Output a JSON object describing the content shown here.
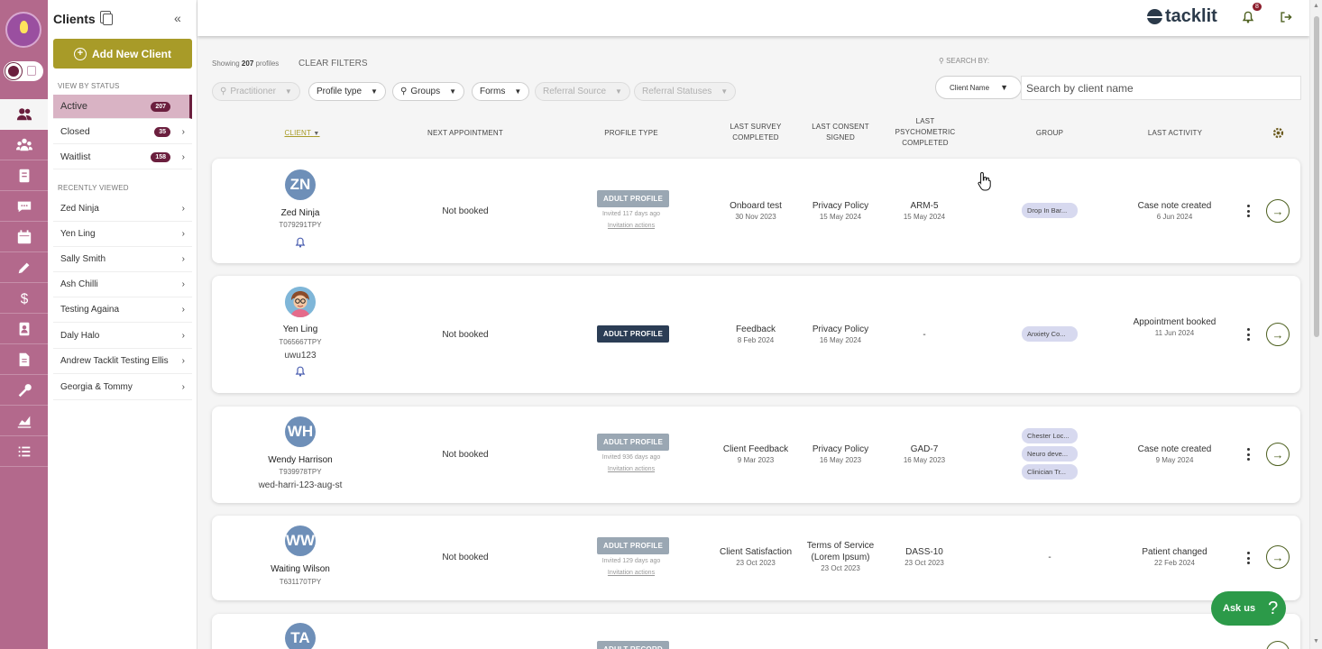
{
  "sidebar": {
    "title": "Clients",
    "add_button": "Add New Client",
    "view_by_status_label": "VIEW BY STATUS",
    "statuses": [
      {
        "label": "Active",
        "count": "207"
      },
      {
        "label": "Closed",
        "count": "35"
      },
      {
        "label": "Waitlist",
        "count": "158"
      }
    ],
    "recently_viewed_label": "RECENTLY VIEWED",
    "recent": [
      "Zed Ninja",
      "Yen Ling",
      "Sally Smith",
      "Ash Chilli",
      "Testing Againa",
      "Daly Halo",
      "Andrew Tacklit Testing Ellis",
      "Georgia & Tommy"
    ]
  },
  "topbar": {
    "brand": "tacklit",
    "notification_count": "8"
  },
  "filters": {
    "showing_prefix": "Showing",
    "showing_count": "207",
    "showing_suffix": "profiles",
    "clear_filters": "CLEAR FILTERS",
    "chips": [
      "Practitioner",
      "Profile type",
      "Groups",
      "Forms",
      "Referral Source",
      "Referral Statuses"
    ],
    "search_by_label": "SEARCH BY:",
    "search_field": "Client Name",
    "search_placeholder": "Search by client name"
  },
  "columns": {
    "client": "CLIENT",
    "next_appointment": "NEXT APPOINTMENT",
    "profile_type": "PROFILE TYPE",
    "last_survey": "LAST SURVEY COMPLETED",
    "last_consent": "LAST CONSENT SIGNED",
    "last_psychometric": "LAST PSYCHOMETRIC COMPLETED",
    "group": "GROUP",
    "last_activity": "LAST ACTIVITY"
  },
  "clients": [
    {
      "initials": "ZN",
      "name": "Zed Ninja",
      "id": "T079291TPY",
      "alias": "",
      "next_appointment": "Not booked",
      "profile_type": "ADULT PROFILE",
      "invited": "Invited 117 days ago",
      "invitation_actions": "Invitation actions",
      "survey": "Onboard test",
      "survey_date": "30 Nov 2023",
      "consent": "Privacy Policy",
      "consent_date": "15 May 2024",
      "psychometric": "ARM-5",
      "psychometric_date": "15 May 2024",
      "groups": [
        "Drop In Bar..."
      ],
      "activity": "Case note created",
      "activity_date": "6 Jun 2024"
    },
    {
      "initials": "",
      "name": "Yen Ling",
      "id": "T065667TPY",
      "alias": "uwu123",
      "next_appointment": "Not booked",
      "profile_type": "ADULT PROFILE",
      "invited": "",
      "invitation_actions": "",
      "survey": "Feedback",
      "survey_date": "8 Feb 2024",
      "consent": "Privacy Policy",
      "consent_date": "16 May 2024",
      "psychometric": "-",
      "psychometric_date": "",
      "groups": [
        "Anxiety Co..."
      ],
      "activity": "Appointment booked",
      "activity_date": "11 Jun 2024"
    },
    {
      "initials": "WH",
      "name": "Wendy Harrison",
      "id": "T939978TPY",
      "alias": "wed-harri-123-aug-st",
      "next_appointment": "Not booked",
      "profile_type": "ADULT PROFILE",
      "invited": "Invited 936 days ago",
      "invitation_actions": "Invitation actions",
      "survey": "Client Feedback",
      "survey_date": "9 Mar 2023",
      "consent": "Privacy Policy",
      "consent_date": "16 May 2023",
      "psychometric": "GAD-7",
      "psychometric_date": "16 May 2023",
      "groups": [
        "Chester Loc...",
        "Neuro deve...",
        "Clinician Tr..."
      ],
      "activity": "Case note created",
      "activity_date": "9 May 2024"
    },
    {
      "initials": "WW",
      "name": "Waiting Wilson",
      "id": "T631170TPY",
      "alias": "",
      "next_appointment": "Not booked",
      "profile_type": "ADULT PROFILE",
      "invited": "Invited 129 days ago",
      "invitation_actions": "Invitation actions",
      "survey": "Client Satisfaction",
      "survey_date": "23 Oct 2023",
      "consent": "Terms of Service (Lorem Ipsum)",
      "consent_date": "23 Oct 2023",
      "psychometric": "DASS-10",
      "psychometric_date": "23 Oct 2023",
      "groups_text": "-",
      "activity": "Patient changed",
      "activity_date": "22 Feb 2024"
    },
    {
      "initials": "TA",
      "profile_type": "ADULT RECORD"
    }
  ],
  "ask_us": "Ask us",
  "ask_us_icon": "?",
  "colors": {
    "rail": "#b3698c",
    "accent_olive": "#a89b28",
    "badge_maroon": "#6b1f3e",
    "brand_navy": "#2b3a4a",
    "ask_green": "#2c9a49"
  }
}
